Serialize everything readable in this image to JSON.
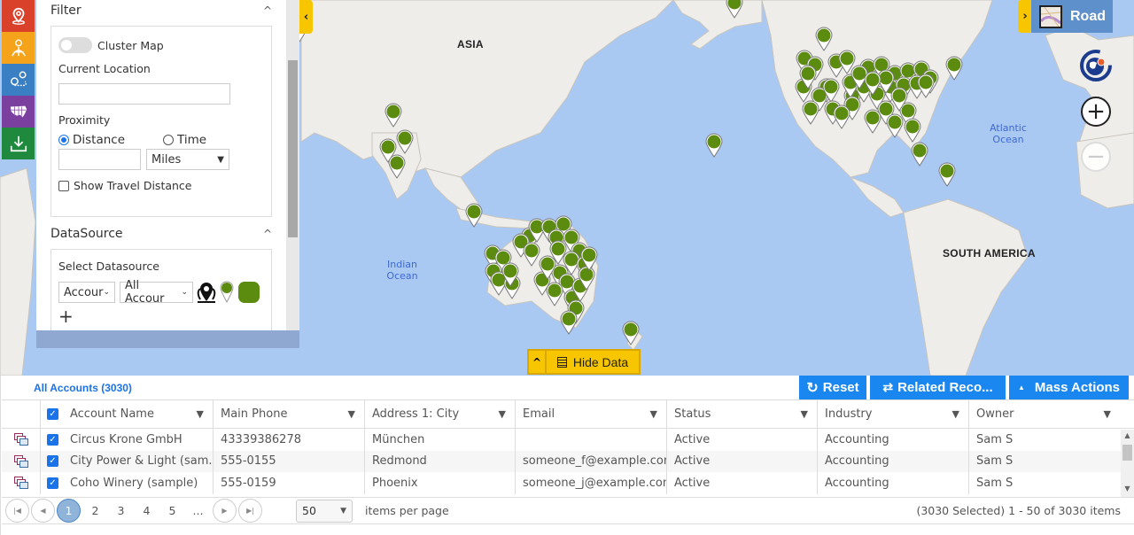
{
  "map": {
    "continent_labels": [
      "ASIA",
      "SOUTH AMERICA"
    ],
    "ocean_labels": [
      "Indian Ocean",
      "Atlantic Ocean"
    ],
    "map_type_label": "Road",
    "pin_color": "#5b8c0f",
    "hide_data_label": "Hide Data"
  },
  "left_tools": [
    {
      "name": "map-pin-icon",
      "color": "#d9412a"
    },
    {
      "name": "territory-globe-icon",
      "color": "#f5a31a"
    },
    {
      "name": "route-icon",
      "color": "#3a7fc4"
    },
    {
      "name": "us-map-icon",
      "color": "#7b3fa0"
    },
    {
      "name": "download-icon",
      "color": "#1f8a3d"
    }
  ],
  "filter": {
    "title": "Filter",
    "cluster_map_label": "Cluster Map",
    "current_location_label": "Current Location",
    "current_location_value": "",
    "proximity_label": "Proximity",
    "distance_label": "Distance",
    "time_label": "Time",
    "distance_value": "",
    "unit_selected": "Miles",
    "show_travel_distance_label": "Show Travel Distance"
  },
  "datasource": {
    "title": "DataSource",
    "select_label": "Select Datasource",
    "entity_selected": "Accour",
    "view_selected": "All Accour",
    "add_label": "+"
  },
  "data_panel": {
    "view_title": "All Accounts (3030)",
    "buttons": {
      "reset": "Reset",
      "related": "Related Reco...",
      "mass_actions": "Mass Actions"
    },
    "columns": [
      "Account Name",
      "Main Phone",
      "Address 1: City",
      "Email",
      "Status",
      "Industry",
      "Owner"
    ],
    "rows": [
      {
        "name": "Circus Krone GmbH",
        "phone": "43339386278",
        "city": "München",
        "email": "",
        "status": "Active",
        "industry": "Accounting",
        "owner": "Sam S"
      },
      {
        "name": "City Power & Light (sam...",
        "phone": "555-0155",
        "city": "Redmond",
        "email": "someone_f@example.com",
        "status": "Active",
        "industry": "Accounting",
        "owner": "Sam S"
      },
      {
        "name": "Coho Winery (sample)",
        "phone": "555-0159",
        "city": "Phoenix",
        "email": "someone_j@example.com",
        "status": "Active",
        "industry": "Accounting",
        "owner": "Sam S"
      }
    ],
    "pager": {
      "pages": [
        "1",
        "2",
        "3",
        "4",
        "5",
        "..."
      ],
      "current_page": "1",
      "page_size": "50",
      "items_per_page_label": "items per page",
      "info": "(3030 Selected) 1 - 50 of 3030 items"
    }
  }
}
